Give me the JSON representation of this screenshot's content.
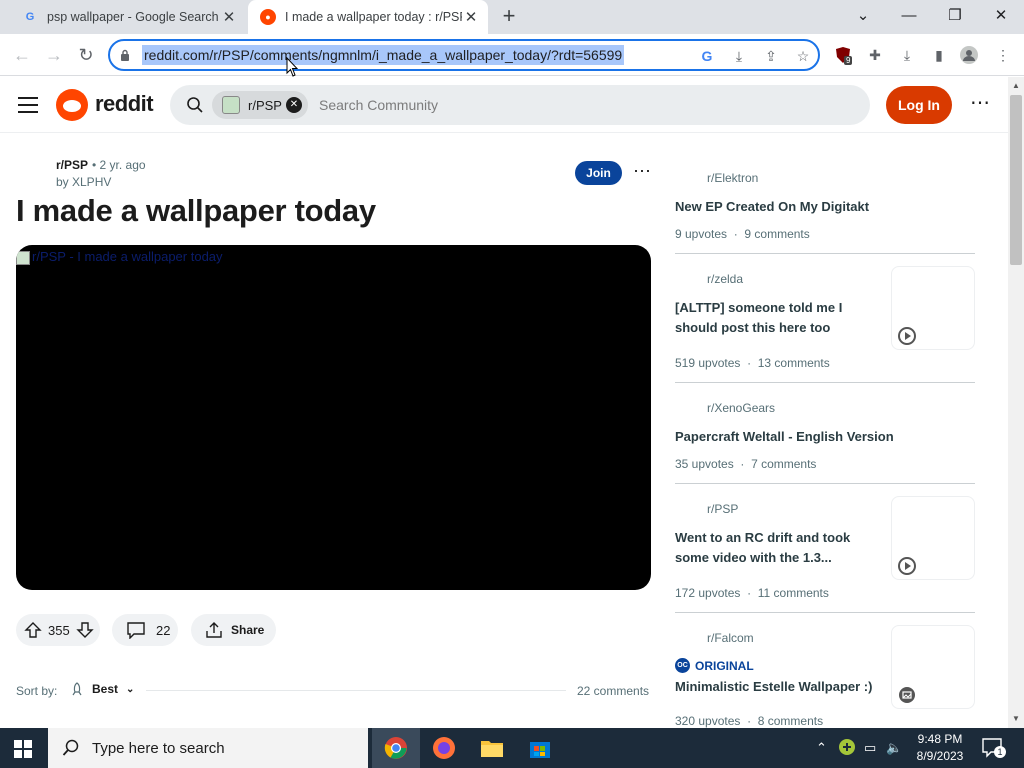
{
  "browser": {
    "tabs": [
      {
        "title": "psp wallpaper - Google Search",
        "favicon": "google-icon",
        "active": false
      },
      {
        "title": "I made a wallpaper today : r/PSP",
        "favicon": "reddit-icon",
        "active": true
      }
    ],
    "url": "reddit.com/r/PSP/comments/ngmnlm/i_made_a_wallpaper_today/?rdt=56599",
    "extension_badge": "9"
  },
  "header": {
    "logo_text": "reddit",
    "community_chip": "r/PSP",
    "search_placeholder": "Search Community",
    "login_label": "Log In",
    "more_label": "⋯"
  },
  "post": {
    "subreddit": "r/PSP",
    "time": "• 2 yr. ago",
    "author": "by XLPHV",
    "join_label": "Join",
    "title": "I made a wallpaper today",
    "media_alt": "r/PSP - I made a wallpaper today",
    "votes": "355",
    "comments": "22",
    "share_label": "Share",
    "sort_label": "Sort by:",
    "sort_value": "Best",
    "comment_count_label": "22 comments"
  },
  "sidebar": {
    "items": [
      {
        "subreddit": "r/Elektron",
        "title": "New EP Created On My Digitakt",
        "upvotes": "9 upvotes",
        "comments": "9 comments",
        "thumb": false
      },
      {
        "subreddit": "r/zelda",
        "title": "[ALTTP] someone told me I should post this here too",
        "upvotes": "519 upvotes",
        "comments": "13 comments",
        "thumb": true
      },
      {
        "subreddit": "r/XenoGears",
        "title": "Papercraft Weltall - English Version",
        "upvotes": "35 upvotes",
        "comments": "7 comments",
        "thumb": false
      },
      {
        "subreddit": "r/PSP",
        "title": "Went to an RC drift and took some video with the 1.3...",
        "upvotes": "172 upvotes",
        "comments": "11 comments",
        "thumb": true
      },
      {
        "subreddit": "r/Falcom",
        "badge": "ORIGINAL",
        "badge_icon": "OC",
        "title": "Minimalistic Estelle Wallpaper :)",
        "upvotes": "320 upvotes",
        "comments": "8 comments",
        "thumb": true
      }
    ],
    "dot": "·"
  },
  "taskbar": {
    "search_placeholder": "Type here to search",
    "time": "9:48 PM",
    "date": "8/9/2023",
    "notif_count": "1"
  },
  "colors": {
    "reddit_orange": "#ff4500",
    "login_button": "#d93a00",
    "join_button": "#0a449b",
    "url_highlight": "#a8c7fa",
    "focus_ring": "#1a73e8"
  }
}
